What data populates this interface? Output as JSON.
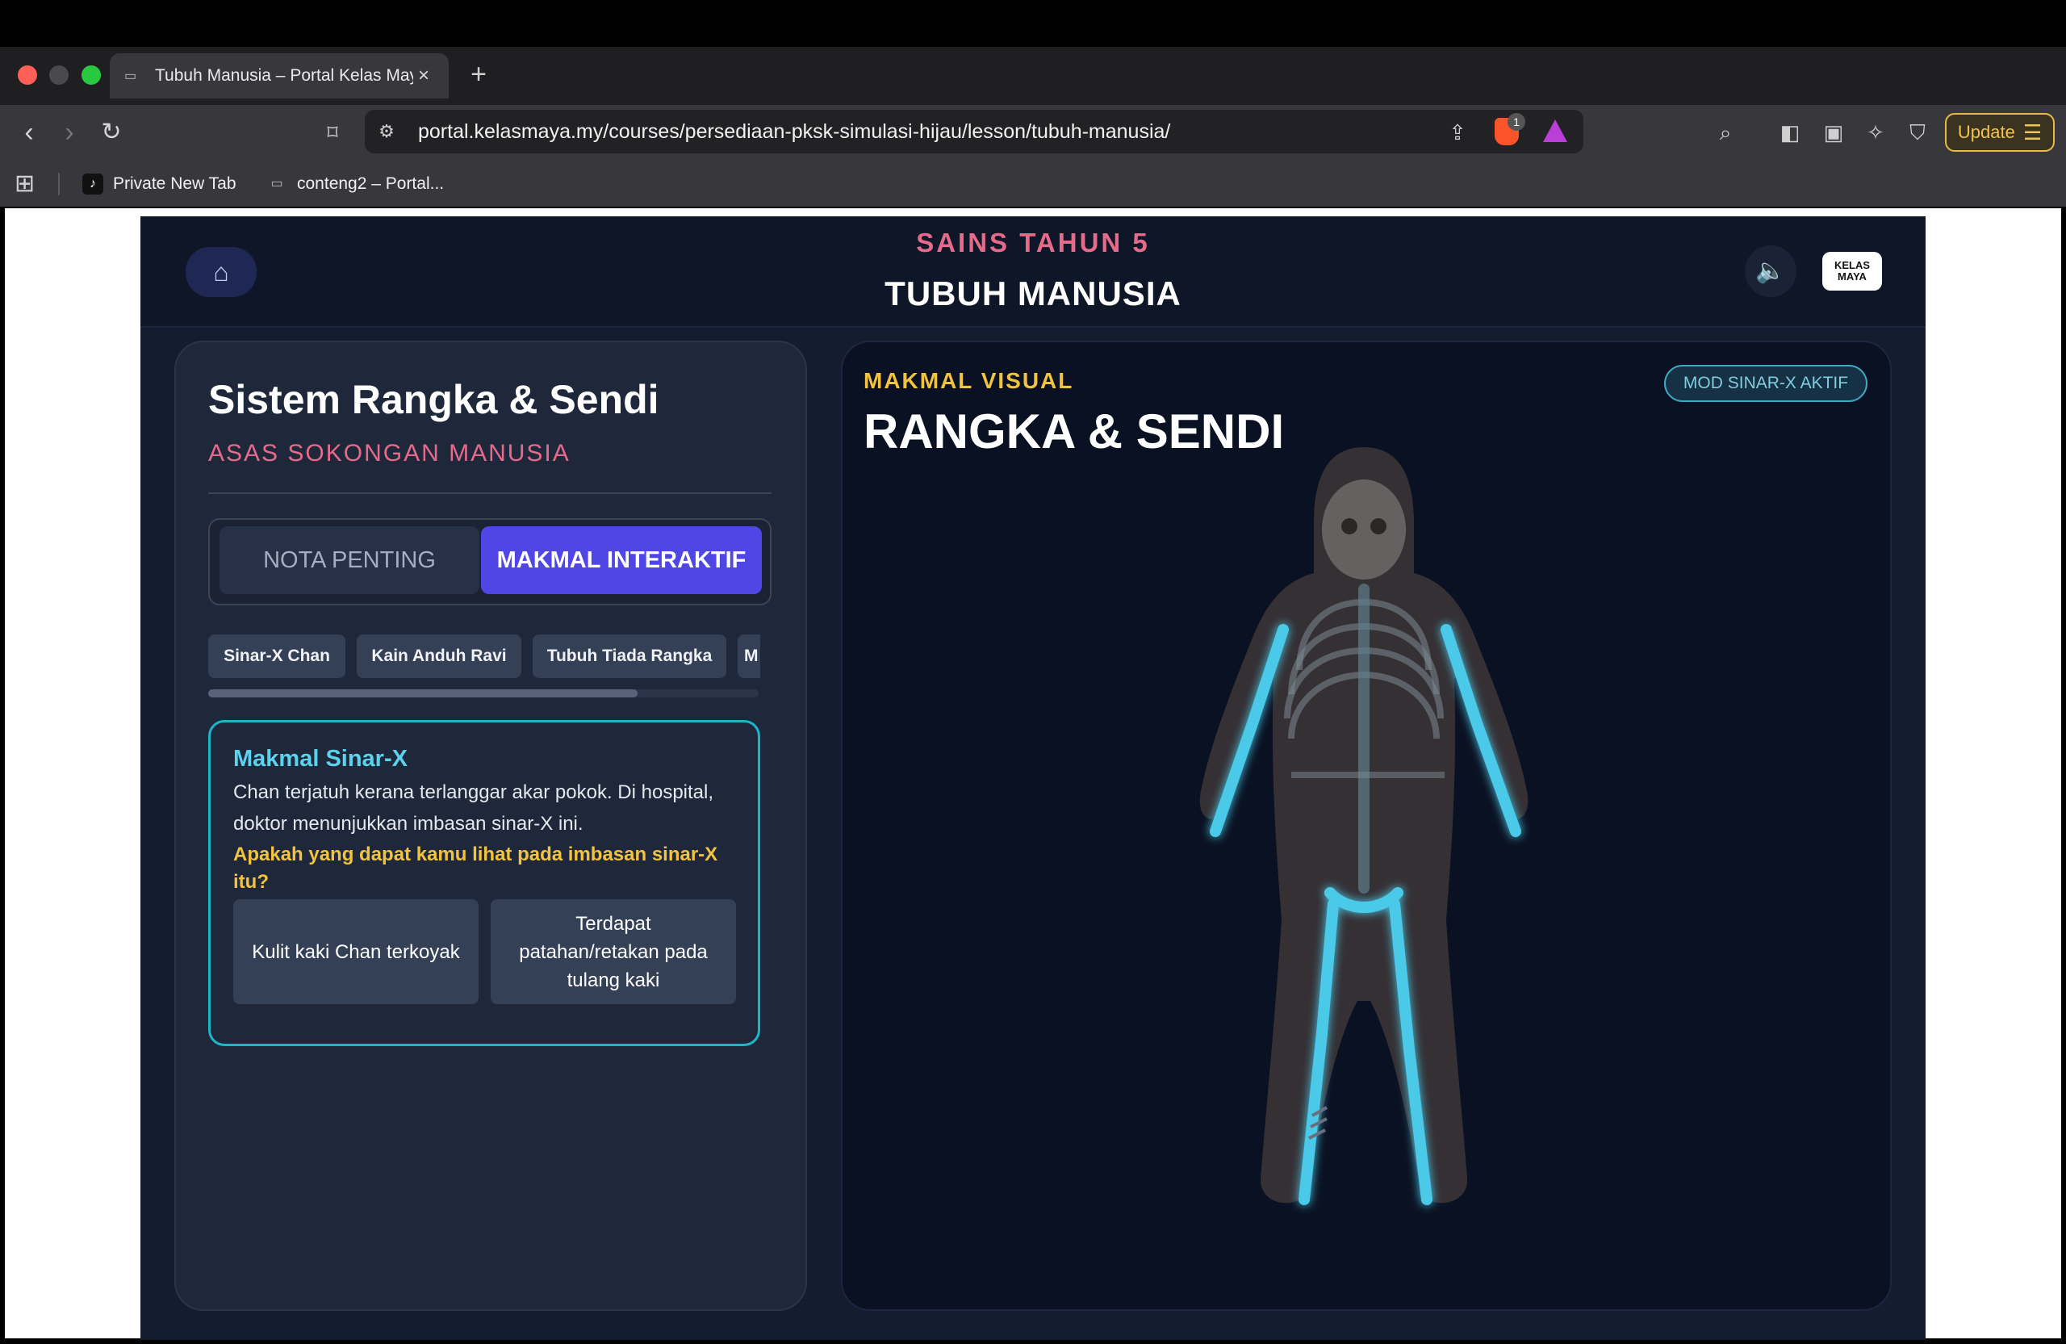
{
  "browser": {
    "tab_title": "Tubuh Manusia – Portal Kelas Maya",
    "url": "portal.kelasmaya.my/courses/persediaan-pksk-simulasi-hijau/lesson/tubuh-manusia/",
    "shield_count": "1",
    "update_label": "Update",
    "bookmarks": [
      "Private New Tab",
      "conteng2 – Portal..."
    ]
  },
  "header": {
    "subject": "SAINS TAHUN 5",
    "topic": "TUBUH MANUSIA",
    "logo_text": "KELAS MAYA"
  },
  "left_panel": {
    "title": "Sistem Rangka & Sendi",
    "subtitle": "ASAS SOKONGAN MANUSIA",
    "tabs": [
      {
        "label": "NOTA PENTING",
        "active": false
      },
      {
        "label": "MAKMAL INTERAKTIF",
        "active": true
      }
    ],
    "chips": [
      "Sinar-X Chan",
      "Kain Anduh Ravi",
      "Tubuh Tiada Rangka",
      "M"
    ],
    "lab": {
      "title": "Makmal Sinar-X",
      "text": "Chan terjatuh kerana terlanggar akar pokok. Di hospital, doktor menunjukkan imbasan sinar-X ini.",
      "question": "Apakah yang dapat kamu lihat pada imbasan sinar-X itu?",
      "options": [
        "Kulit kaki Chan terkoyak",
        "Terdapat patahan/retakan pada tulang kaki"
      ]
    }
  },
  "right_panel": {
    "label": "MAKMAL VISUAL",
    "title": "RANGKA & SENDI",
    "badge": "MOD SINAR-X AKTIF"
  },
  "colors": {
    "accent": "#4f46e5",
    "pink": "#e56b8a",
    "yellow": "#f2c33f",
    "cyan": "#5cd3ec",
    "bone_glow": "#4cc9e8",
    "background": "#141c2f"
  }
}
